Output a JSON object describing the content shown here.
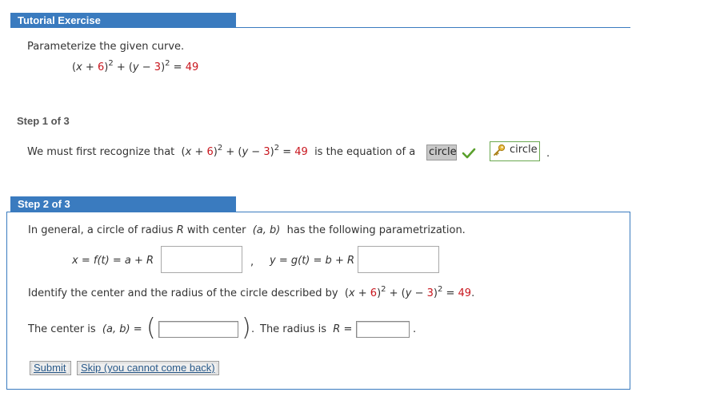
{
  "header": {
    "title": "Tutorial Exercise"
  },
  "problem": {
    "instruction": "Parameterize the given curve.",
    "equation": {
      "x_part": "x",
      "x_const": "6",
      "y_part": "y",
      "y_const": "3",
      "rhs": "49",
      "exp": "2"
    }
  },
  "step1": {
    "label": "Step 1 of 3",
    "text_before": "We must first recognize that",
    "text_after": "is the equation of a",
    "answer_value": "circle",
    "correct_answer": "circle",
    "period": "."
  },
  "step2": {
    "label": "Step 2 of 3",
    "intro_a": "In general, a circle of radius",
    "intro_R": "R",
    "intro_b": "with center",
    "intro_center": "(a, b)",
    "intro_c": "has the following parametrization.",
    "x_eq": {
      "lhs": "x",
      "func": "f(t)",
      "a": "a",
      "R": "R"
    },
    "comma": ",",
    "y_eq": {
      "lhs": "y",
      "func": "g(t)",
      "b": "b",
      "R": "R"
    },
    "identify_text": "Identify the center and the radius of the circle described by",
    "identify_period": ".",
    "center_label": "The center is",
    "center_var": "(a, b)",
    "radius_label": "The radius is",
    "radius_var": "R",
    "radius_period": "."
  },
  "buttons": {
    "submit": "Submit",
    "skip": "Skip (you cannot come back)"
  },
  "colors": {
    "accent": "#3a7bbf",
    "red_number": "#c8161e",
    "check_green": "#5aa02c"
  }
}
